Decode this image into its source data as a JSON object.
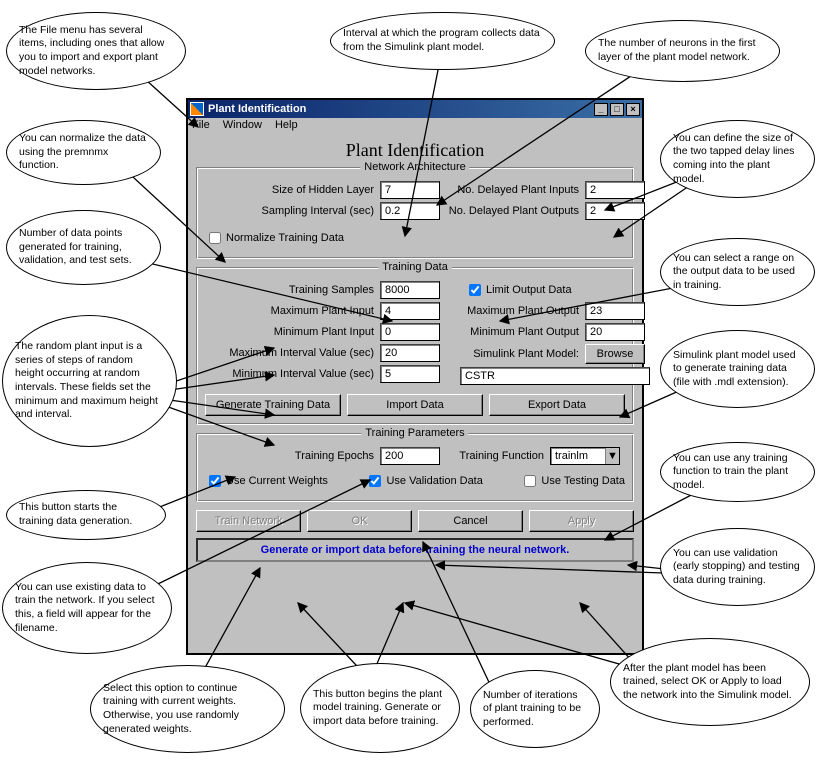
{
  "window": {
    "title": "Plant Identification",
    "menu": {
      "file": "File",
      "window": "Window",
      "help": "Help"
    },
    "heading": "Plant Identification"
  },
  "arch": {
    "legend": "Network Architecture",
    "hidden_label": "Size of Hidden Layer",
    "hidden_value": "7",
    "delayed_in_label": "No. Delayed Plant Inputs",
    "delayed_in_value": "2",
    "sampling_label": "Sampling Interval (sec)",
    "sampling_value": "0.2",
    "delayed_out_label": "No. Delayed Plant Outputs",
    "delayed_out_value": "2",
    "normalize_label": "Normalize Training Data"
  },
  "tdata": {
    "legend": "Training Data",
    "samples_label": "Training Samples",
    "samples_value": "8000",
    "limit_label": "Limit Output Data",
    "maxin_label": "Maximum Plant Input",
    "maxin_value": "4",
    "maxout_label": "Maximum Plant Output",
    "maxout_value": "23",
    "minin_label": "Minimum Plant Input",
    "minin_value": "0",
    "minout_label": "Minimum Plant Output",
    "minout_value": "20",
    "maxint_label": "Maximum Interval Value (sec)",
    "maxint_value": "20",
    "model_label": "Simulink Plant Model:",
    "browse": "Browse",
    "minint_label": "Minimum Interval Value (sec)",
    "minint_value": "5",
    "model_value": "CSTR",
    "gen": "Generate Training Data",
    "imp": "Import Data",
    "exp": "Export Data"
  },
  "tparam": {
    "legend": "Training Parameters",
    "epochs_label": "Training Epochs",
    "epochs_value": "200",
    "func_label": "Training Function",
    "func_value": "trainlm",
    "usecw": "Use Current Weights",
    "usevd": "Use Validation Data",
    "usetd": "Use Testing Data"
  },
  "buttons": {
    "train": "Train Network",
    "ok": "OK",
    "cancel": "Cancel",
    "apply": "Apply"
  },
  "status": "Generate or import data before training the neural network.",
  "balloons": {
    "file_menu": "The File menu has several items, including ones that allow you to import and export plant model networks.",
    "sampling": "Interval at which the program collects data from the Simulink plant model.",
    "neurons": "The number of neurons in the first layer of the plant model network.",
    "normalize": "You can normalize the data using the premnmx function.",
    "delays": "You can define the size of the two tapped delay lines coming into the plant model.",
    "numpoints": "Number of data points generated for training, validation, and test sets.",
    "limit": "You can select a range on the output data to be used in training.",
    "random": "The random plant input is a series of steps of random height occurring at random intervals. These fields set the minimum and maximum height and interval.",
    "simmdl": "Simulink plant model used to generate training data (file with .mdl extension).",
    "gendata": "This button starts the training data generation.",
    "anytrain": "You can use any training function to train the plant model.",
    "existing": "You can use existing data to train the network. If you select this, a field will appear for the filename.",
    "valtest": "You can use validation (early stopping) and testing data during training.",
    "curw": "Select this option to continue training with current weights. Otherwise, you use randomly generated weights.",
    "trainbtn": "This button begins the plant model training. Generate or import data before training.",
    "iters": "Number of iterations of plant training to be performed.",
    "okapply": "After the plant model has been trained, select OK or Apply to load the network into the Simulink model."
  }
}
